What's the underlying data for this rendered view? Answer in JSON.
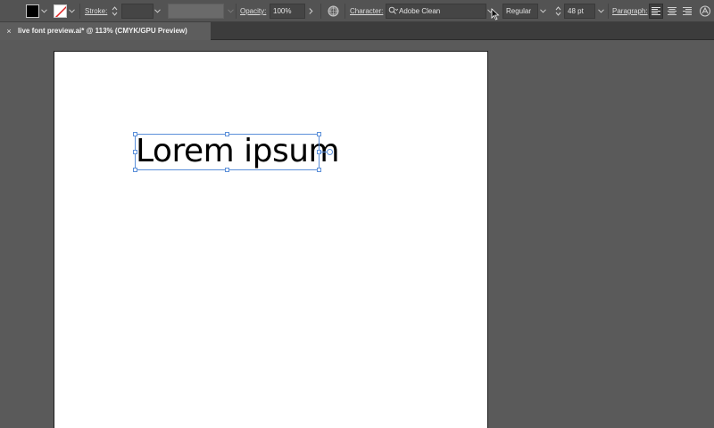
{
  "control_bar": {
    "stroke_label": "Stroke:",
    "opacity_label": "Opacity:",
    "opacity_value": "100%",
    "character_label": "Character:",
    "font_family": "Adobe Clean",
    "font_style": "Regular",
    "font_size": "48 pt",
    "paragraph_label": "Paragraph:"
  },
  "document": {
    "tab_title": "live font preview.ai* @ 113% (CMYK/GPU Preview)",
    "close_glyph": "×"
  },
  "artboard": {
    "text": "Lorem ipsum"
  },
  "colors": {
    "fill": "#000000",
    "selection": "#5b8fd9",
    "panel": "#535353",
    "canvas": "#5a5a5a"
  }
}
